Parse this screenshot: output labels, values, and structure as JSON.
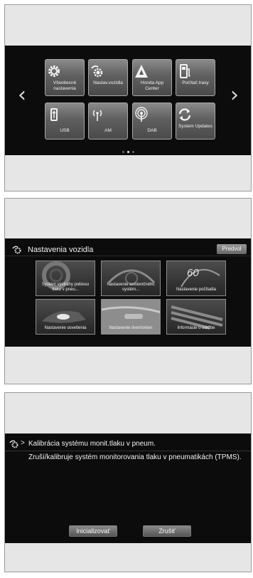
{
  "home": {
    "tiles": [
      {
        "label": "Všeobecné nastavenia",
        "icon": "gear-icon"
      },
      {
        "label": "Nastav.vozidla",
        "icon": "car-gear-icon"
      },
      {
        "label": "Honda App Center",
        "icon": "app-center-icon"
      },
      {
        "label": "Počítač trasy",
        "icon": "fuel-pump-icon"
      },
      {
        "label": "USB",
        "icon": "usb-icon"
      },
      {
        "label": "AM",
        "icon": "am-radio-icon"
      },
      {
        "label": "DAB",
        "icon": "dab-radio-icon"
      },
      {
        "label": "System Updates",
        "icon": "refresh-icon"
      }
    ],
    "prev_arrow": "‹",
    "next_arrow": "›",
    "page_count": 3,
    "active_page": 2
  },
  "vehicle_settings": {
    "title": "Nastavenia vozidla",
    "preset_button": "Predvol",
    "tiles": [
      {
        "label": "Systém výstrahy poklesu tlaku v pneu..."
      },
      {
        "label": "Nastavenie asistenčného systém..."
      },
      {
        "label": "Nastavenie počítadla",
        "value": "60"
      },
      {
        "label": "Nastavenie osvetlenia"
      },
      {
        "label": "Nastavenie dverí/okien"
      },
      {
        "label": "Informácie o údržbe"
      }
    ]
  },
  "tpms": {
    "breadcrumb_sep": ">",
    "title": "Kalibrácia systému monit.tlaku v pneum.",
    "body": "Zruší/kalibruje systém monitorovania tlaku v pneumatikách (TPMS).",
    "initialize_button": "Inicializovať",
    "cancel_button": "Zrušiť"
  },
  "colors": {
    "screen": "#0c0c0c",
    "tile": "#5f5f5f",
    "accent_dab": "#e8e8e8"
  }
}
